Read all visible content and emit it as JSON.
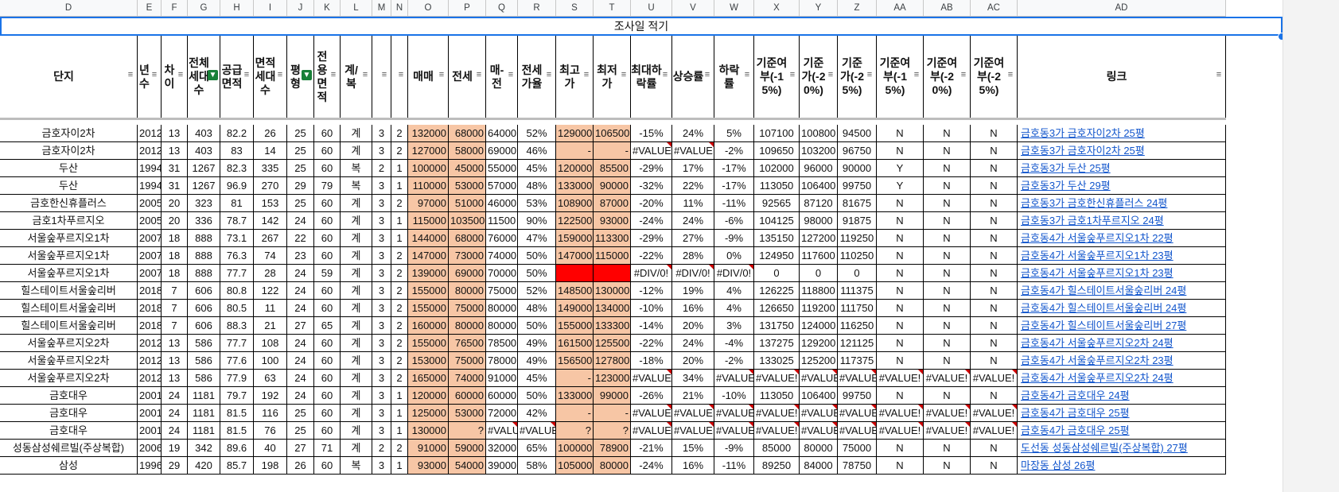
{
  "columns": [
    {
      "letter": "D",
      "w": 173,
      "header": "단지",
      "filter": "plain",
      "align": "ctr"
    },
    {
      "letter": "E",
      "w": 30,
      "header": "년수",
      "filter": "plain",
      "align": "ctr"
    },
    {
      "letter": "F",
      "w": 33,
      "header": "차이",
      "filter": "plain",
      "align": "ctr"
    },
    {
      "letter": "G",
      "w": 41,
      "header": "전체세대수",
      "filter": "active",
      "align": "ctr"
    },
    {
      "letter": "H",
      "w": 42,
      "header": "공급면적",
      "filter": "plain",
      "align": "ctr"
    },
    {
      "letter": "I",
      "w": 42,
      "header": "면적세대수",
      "filter": "plain",
      "align": "ctr"
    },
    {
      "letter": "J",
      "w": 34,
      "header": "평형",
      "filter": "active",
      "align": "ctr"
    },
    {
      "letter": "K",
      "w": 33,
      "header": "전용면적",
      "filter": "plain",
      "align": "ctr"
    },
    {
      "letter": "L",
      "w": 40,
      "header": "계/복",
      "filter": "plain",
      "align": "ctr"
    },
    {
      "letter": "M",
      "w": 24,
      "header": "",
      "filter": "plain",
      "align": "ctr"
    },
    {
      "letter": "N",
      "w": 21,
      "header": "",
      "filter": "plain",
      "align": "ctr"
    },
    {
      "letter": "O",
      "w": 51,
      "header": "매매",
      "filter": "plain",
      "align": "rt",
      "cls": "pch"
    },
    {
      "letter": "P",
      "w": 47,
      "header": "전세",
      "filter": "plain",
      "align": "rt",
      "cls": "pch"
    },
    {
      "letter": "Q",
      "w": 40,
      "header": "매-전",
      "filter": "plain",
      "align": "rt"
    },
    {
      "letter": "R",
      "w": 48,
      "header": "전세가율",
      "filter": "plain",
      "align": "ctr"
    },
    {
      "letter": "S",
      "w": 47,
      "header": "최고가",
      "filter": "plain",
      "align": "rt",
      "cls": "pch"
    },
    {
      "letter": "T",
      "w": 47,
      "header": "최저가",
      "filter": "plain",
      "align": "rt",
      "cls": "pch"
    },
    {
      "letter": "U",
      "w": 52,
      "header": "최대하락률",
      "filter": "plain",
      "align": "ctr"
    },
    {
      "letter": "V",
      "w": 53,
      "header": "상승률",
      "filter": "plain",
      "align": "ctr"
    },
    {
      "letter": "W",
      "w": 50,
      "header": "하락률",
      "filter": "plain",
      "align": "ctr"
    },
    {
      "letter": "X",
      "w": 57,
      "header": "기준여부(-15%)",
      "filter": "plain",
      "align": "ctr"
    },
    {
      "letter": "Y",
      "w": 48,
      "header": "기준가(-20%)",
      "filter": "plain",
      "align": "ctr"
    },
    {
      "letter": "Z",
      "w": 49,
      "header": "기준가(-25%)",
      "filter": "plain",
      "align": "ctr"
    },
    {
      "letter": "AA",
      "w": 59,
      "header": "기준여부(-15%)",
      "filter": "plain",
      "align": "ctr"
    },
    {
      "letter": "AB",
      "w": 59,
      "header": "기준여부(-20%)",
      "filter": "plain",
      "align": "ctr"
    },
    {
      "letter": "AC",
      "w": 59,
      "header": "기준여부(-25%)",
      "filter": "plain",
      "align": "ctr"
    },
    {
      "letter": "AD",
      "w": 262,
      "header": "링크",
      "filter": "plain",
      "align": "lnk"
    }
  ],
  "banner": "조사일 적기",
  "rows": [
    [
      "금호자이2차",
      "2012",
      "13",
      "403",
      "82.2",
      "26",
      "25",
      "60",
      "계",
      "3",
      "2",
      "132000",
      "68000",
      "64000",
      "52%",
      "129000",
      "106500",
      "-15%",
      "24%",
      "5%",
      "107100",
      "100800",
      "94500",
      "N",
      "N",
      "N",
      "금호동3가 금호자이2차 25평"
    ],
    [
      "금호자이2차",
      "2012",
      "13",
      "403",
      "83",
      "14",
      "25",
      "60",
      "계",
      "3",
      "2",
      "127000",
      "58000",
      "69000",
      "46%",
      "-",
      "-",
      "#VALUE!",
      "#VALUE!",
      "-2%",
      "109650",
      "103200",
      "96750",
      "N",
      "N",
      "N",
      "금호동3가 금호자이2차 25평"
    ],
    [
      "두산",
      "1994",
      "31",
      "1267",
      "82.3",
      "335",
      "25",
      "60",
      "복",
      "2",
      "1",
      "100000",
      "45000",
      "55000",
      "45%",
      "120000",
      "85500",
      "-29%",
      "17%",
      "-17%",
      "102000",
      "96000",
      "90000",
      "Y",
      "N",
      "N",
      "금호동3가 두산 25평"
    ],
    [
      "두산",
      "1994",
      "31",
      "1267",
      "96.9",
      "270",
      "29",
      "79",
      "복",
      "3",
      "1",
      "110000",
      "53000",
      "57000",
      "48%",
      "133000",
      "90000",
      "-32%",
      "22%",
      "-17%",
      "113050",
      "106400",
      "99750",
      "Y",
      "N",
      "N",
      "금호동3가 두산 29평"
    ],
    [
      "금호한신휴플러스",
      "2005",
      "20",
      "323",
      "81",
      "153",
      "25",
      "60",
      "계",
      "3",
      "2",
      "97000",
      "51000",
      "46000",
      "53%",
      "108900",
      "87000",
      "-20%",
      "11%",
      "-11%",
      "92565",
      "87120",
      "81675",
      "N",
      "N",
      "N",
      "금호동3가 금호한신휴플러스 24평"
    ],
    [
      "금호1차푸르지오",
      "2005",
      "20",
      "336",
      "78.7",
      "142",
      "24",
      "60",
      "계",
      "3",
      "1",
      "115000",
      "103500",
      "11500",
      "90%",
      "122500",
      "93000",
      "-24%",
      "24%",
      "-6%",
      "104125",
      "98000",
      "91875",
      "N",
      "N",
      "N",
      "금호동3가 금호1차푸르지오 24평"
    ],
    [
      "서울숲푸르지오1차",
      "2007",
      "18",
      "888",
      "73.1",
      "267",
      "22",
      "60",
      "계",
      "3",
      "1",
      "144000",
      "68000",
      "76000",
      "47%",
      "159000",
      "113300",
      "-29%",
      "27%",
      "-9%",
      "135150",
      "127200",
      "119250",
      "N",
      "N",
      "N",
      "금호동4가 서울숲푸르지오1차 22평"
    ],
    [
      "서울숲푸르지오1차",
      "2007",
      "18",
      "888",
      "76.3",
      "74",
      "23",
      "60",
      "계",
      "3",
      "2",
      "147000",
      "73000",
      "74000",
      "50%",
      "147000",
      "115000",
      "-22%",
      "28%",
      "0%",
      "124950",
      "117600",
      "110250",
      "N",
      "N",
      "N",
      "금호동4가 서울숲푸르지오1차 23평"
    ],
    [
      "서울숲푸르지오1차",
      "2007",
      "18",
      "888",
      "77.7",
      "28",
      "24",
      "59",
      "계",
      "3",
      "2",
      "139000",
      "69000",
      "70000",
      "50%",
      "",
      "",
      "#DIV/0!",
      "#DIV/0!",
      "#DIV/0!",
      "0",
      "0",
      "0",
      "N",
      "N",
      "N",
      "금호동4가 서울숲푸르지오1차 23평"
    ],
    [
      "힐스테이트서울숲리버",
      "2018",
      "7",
      "606",
      "80.8",
      "122",
      "24",
      "60",
      "계",
      "3",
      "2",
      "155000",
      "80000",
      "75000",
      "52%",
      "148500",
      "130000",
      "-12%",
      "19%",
      "4%",
      "126225",
      "118800",
      "111375",
      "N",
      "N",
      "N",
      "금호동4가 힐스테이트서울숲리버 24평"
    ],
    [
      "힐스테이트서울숲리버",
      "2018",
      "7",
      "606",
      "80.5",
      "11",
      "24",
      "60",
      "계",
      "3",
      "2",
      "155000",
      "75000",
      "80000",
      "48%",
      "149000",
      "134000",
      "-10%",
      "16%",
      "4%",
      "126650",
      "119200",
      "111750",
      "N",
      "N",
      "N",
      "금호동4가 힐스테이트서울숲리버 24평"
    ],
    [
      "힐스테이트서울숲리버",
      "2018",
      "7",
      "606",
      "88.3",
      "21",
      "27",
      "65",
      "계",
      "3",
      "2",
      "160000",
      "80000",
      "80000",
      "50%",
      "155000",
      "133300",
      "-14%",
      "20%",
      "3%",
      "131750",
      "124000",
      "116250",
      "N",
      "N",
      "N",
      "금호동4가 힐스테이트서울숲리버 27평"
    ],
    [
      "서울숲푸르지오2차",
      "2012",
      "13",
      "586",
      "77.7",
      "108",
      "24",
      "60",
      "계",
      "3",
      "2",
      "155000",
      "76500",
      "78500",
      "49%",
      "161500",
      "125500",
      "-22%",
      "24%",
      "-4%",
      "137275",
      "129200",
      "121125",
      "N",
      "N",
      "N",
      "금호동4가 서울숲푸르지오2차 24평"
    ],
    [
      "서울숲푸르지오2차",
      "2012",
      "13",
      "586",
      "77.6",
      "100",
      "24",
      "60",
      "계",
      "3",
      "2",
      "153000",
      "75000",
      "78000",
      "49%",
      "156500",
      "127800",
      "-18%",
      "20%",
      "-2%",
      "133025",
      "125200",
      "117375",
      "N",
      "N",
      "N",
      "금호동4가 서울숲푸르지오2차 23평"
    ],
    [
      "서울숲푸르지오2차",
      "2012",
      "13",
      "586",
      "77.9",
      "63",
      "24",
      "60",
      "계",
      "3",
      "2",
      "165000",
      "74000",
      "91000",
      "45%",
      "-",
      "123000",
      "#VALUE!",
      "34%",
      "#VALUE!",
      "#VALUE!",
      "#VALUE!",
      "#VALUE!",
      "#VALUE!",
      "#VALUE!",
      "#VALUE!",
      "금호동4가 서울숲푸르지오2차 24평"
    ],
    [
      "금호대우",
      "2001",
      "24",
      "1181",
      "79.7",
      "192",
      "24",
      "60",
      "계",
      "3",
      "1",
      "120000",
      "60000",
      "60000",
      "50%",
      "133000",
      "99000",
      "-26%",
      "21%",
      "-10%",
      "113050",
      "106400",
      "99750",
      "N",
      "N",
      "N",
      "금호동4가 금호대우 24평"
    ],
    [
      "금호대우",
      "2001",
      "24",
      "1181",
      "81.5",
      "116",
      "25",
      "60",
      "계",
      "3",
      "1",
      "125000",
      "53000",
      "72000",
      "42%",
      "-",
      "-",
      "#VALUE!",
      "#VALUE!",
      "#VALUE!",
      "#VALUE!",
      "#VALUE!",
      "#VALUE!",
      "#VALUE!",
      "#VALUE!",
      "#VALUE!",
      "금호동4가 금호대우 25평"
    ],
    [
      "금호대우",
      "2001",
      "24",
      "1181",
      "81.5",
      "76",
      "25",
      "60",
      "계",
      "3",
      "1",
      "130000",
      "?",
      "#VALUE!",
      "#VALUE!",
      "?",
      "?",
      "#VALUE!",
      "#VALUE!",
      "#VALUE!",
      "#VALUE!",
      "#VALUE!",
      "#VALUE!",
      "#VALUE!",
      "#VALUE!",
      "#VALUE!",
      "금호동4가 금호대우 25평"
    ],
    [
      "성동삼성쉐르빌(주상복합)",
      "2006",
      "19",
      "342",
      "89.6",
      "40",
      "27",
      "71",
      "계",
      "2",
      "2",
      "91000",
      "59000",
      "32000",
      "65%",
      "100000",
      "78900",
      "-21%",
      "15%",
      "-9%",
      "85000",
      "80000",
      "75000",
      "N",
      "N",
      "N",
      "도선동 성동삼성쉐르빌(주상복합) 27평"
    ],
    [
      "삼성",
      "1996",
      "29",
      "420",
      "85.7",
      "198",
      "26",
      "60",
      "복",
      "3",
      "1",
      "93000",
      "54000",
      "39000",
      "58%",
      "105000",
      "80000",
      "-24%",
      "16%",
      "-11%",
      "89250",
      "84000",
      "78750",
      "N",
      "N",
      "N",
      "마장동 삼성 26평"
    ]
  ],
  "colors": {
    "peach": "#f7c6a5",
    "red": "#ff0000",
    "link": "#1155cc",
    "selection": "#1a73e8",
    "filter_active": "#188038"
  }
}
